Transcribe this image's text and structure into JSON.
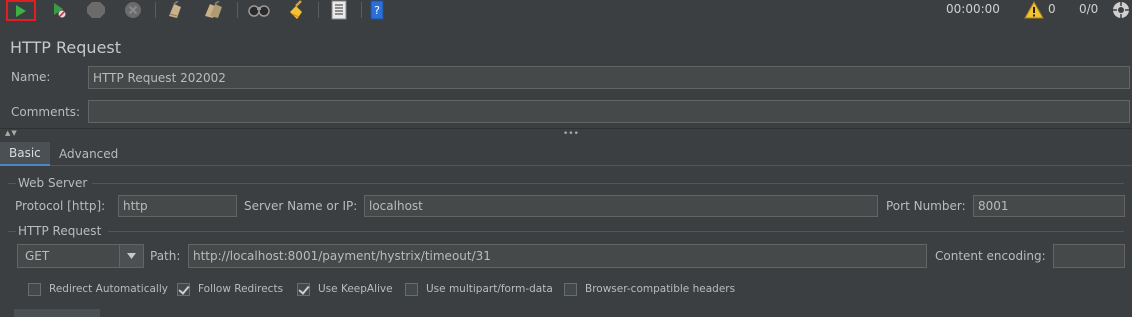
{
  "toolbar": {
    "timer": "00:00:00",
    "warning_count": "0",
    "threads": "0/0",
    "icons": [
      "start-icon",
      "start-no-pause-icon",
      "stop-icon",
      "shutdown-icon",
      "clear-icon",
      "clear-all-icon",
      "search-icon",
      "reset-search-icon",
      "function-helper-icon",
      "help-icon",
      "warning-icon",
      "remote-icon"
    ]
  },
  "title": "HTTP Request",
  "name": {
    "label": "Name:",
    "value": "HTTP Request 202002"
  },
  "comments": {
    "label": "Comments:",
    "value": ""
  },
  "tabs": [
    {
      "label": "Basic",
      "active": true
    },
    {
      "label": "Advanced",
      "active": false
    }
  ],
  "web_server": {
    "title": "Web Server",
    "protocol_label": "Protocol [http]:",
    "protocol_value": "http",
    "server_label": "Server Name or IP:",
    "server_value": "localhost",
    "port_label": "Port Number:",
    "port_value": "8001"
  },
  "http_request": {
    "title": "HTTP Request",
    "method": "GET",
    "path_label": "Path:",
    "path_value": "http://localhost:8001/payment/hystrix/timeout/31",
    "encoding_label": "Content encoding:",
    "encoding_value": ""
  },
  "options": [
    {
      "label": "Redirect Automatically",
      "checked": false
    },
    {
      "label": "Follow Redirects",
      "checked": true
    },
    {
      "label": "Use KeepAlive",
      "checked": true
    },
    {
      "label": "Use multipart/form-data",
      "checked": false
    },
    {
      "label": "Browser-compatible headers",
      "checked": false
    }
  ],
  "colors": {
    "background": "#3c3f41",
    "field": "#45494a",
    "start_highlight": "#e02020",
    "start_green": "#3cb043"
  }
}
